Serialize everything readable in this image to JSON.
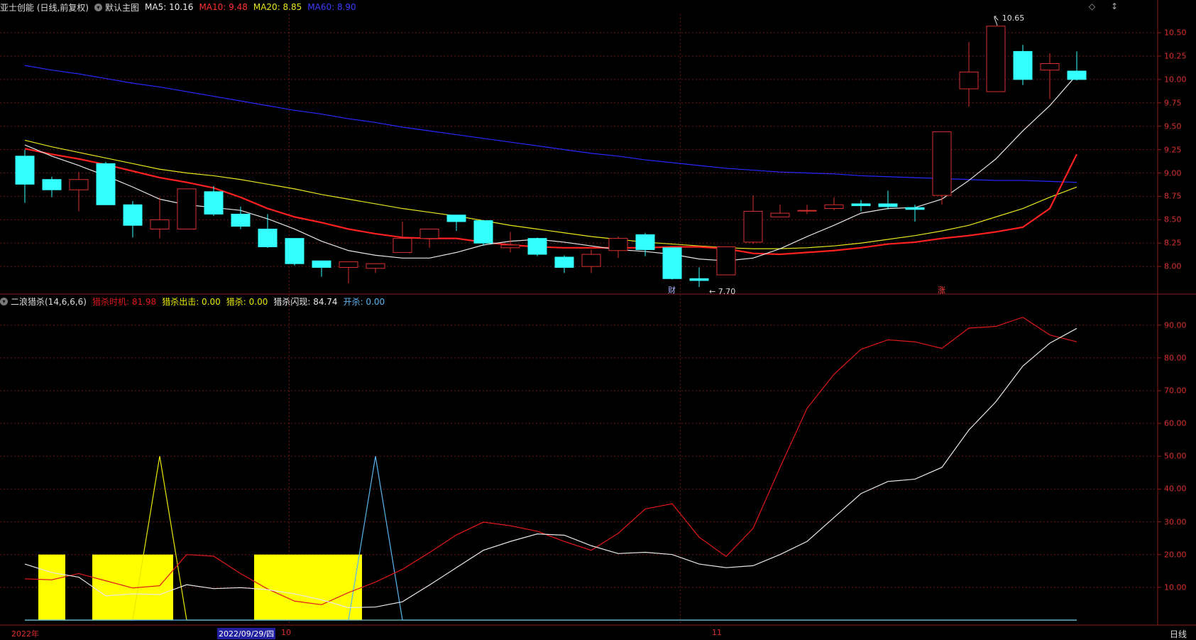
{
  "header_top": {
    "stock": "亚士创能 (日线,前复权)",
    "main_chart": "默认主图",
    "ma5": "MA5: 10.16",
    "ma10": "MA10: 9.48",
    "ma20": "MA20: 8.85",
    "ma60": "MA60: 8.90",
    "icons": [
      "diamond-icon",
      "arrow-updown-icon"
    ]
  },
  "header_bottom": {
    "indicator": "二浪猎杀(14,6,6,6)",
    "timing": "猎杀时机: 81.98",
    "strike": "猎杀出击: 0.00",
    "hunt": "猎杀: 0.00",
    "flash": "猎杀闪现: 84.74",
    "open": "开杀: 0.00"
  },
  "colors": {
    "up": "#d83030",
    "down": "#33ffff",
    "ma5": "#e6e6e6",
    "ma10": "#ff2020",
    "ma20": "#e6e61e",
    "ma60": "#2828ff",
    "timing": "#e01818",
    "flash": "#e8e8e8",
    "strike": "#e8e800",
    "open": "#5ab4f0",
    "bar": "#ffff00",
    "grid": "#6a1616"
  },
  "price_axis": [
    "10.50",
    "10.25",
    "10.00",
    "9.75",
    "9.50",
    "9.25",
    "9.00",
    "8.75",
    "8.50",
    "8.25",
    "8.00"
  ],
  "osc_axis": [
    "90.00",
    "80.00",
    "70.00",
    "60.00",
    "50.00",
    "40.00",
    "30.00",
    "20.00",
    "10.00"
  ],
  "annotations": {
    "high": "10.65",
    "low": "7.70",
    "cai": "财",
    "zhang": "涨"
  },
  "date_axis": {
    "year": "2022年",
    "cursor": "2022/09/29/四",
    "oct": "10",
    "nov": "11",
    "period": "日线"
  },
  "chart_data": {
    "type": "candlestick",
    "candles": [
      [
        9.18,
        8.88,
        9.25,
        8.68
      ],
      [
        8.93,
        8.82,
        8.96,
        8.74
      ],
      [
        8.82,
        8.93,
        9.01,
        8.59
      ],
      [
        9.1,
        8.66,
        9.12,
        8.66
      ],
      [
        8.66,
        8.44,
        8.7,
        8.31
      ],
      [
        8.4,
        8.5,
        8.74,
        8.3
      ],
      [
        8.4,
        8.83,
        8.83,
        8.4
      ],
      [
        8.8,
        8.56,
        8.86,
        8.54
      ],
      [
        8.56,
        8.43,
        8.64,
        8.4
      ],
      [
        8.4,
        8.21,
        8.56,
        8.2
      ],
      [
        8.3,
        8.03,
        8.3,
        8.01
      ],
      [
        8.06,
        7.99,
        8.06,
        7.89
      ],
      [
        7.99,
        8.05,
        8.05,
        7.82
      ],
      [
        7.98,
        8.03,
        8.03,
        7.93
      ],
      [
        8.15,
        8.3,
        8.48,
        8.15
      ],
      [
        8.3,
        8.4,
        8.4,
        8.2
      ],
      [
        8.55,
        8.48,
        8.55,
        8.38
      ],
      [
        8.49,
        8.25,
        8.49,
        8.22
      ],
      [
        8.2,
        8.23,
        8.37,
        8.15
      ],
      [
        8.3,
        8.13,
        8.31,
        8.11
      ],
      [
        8.1,
        7.99,
        8.12,
        7.93
      ],
      [
        8.0,
        8.13,
        8.18,
        7.93
      ],
      [
        8.17,
        8.3,
        8.32,
        8.09
      ],
      [
        8.34,
        8.18,
        8.36,
        8.11
      ],
      [
        8.2,
        7.87,
        8.2,
        7.86
      ],
      [
        7.87,
        7.85,
        7.99,
        7.78
      ],
      [
        7.91,
        8.21,
        8.21,
        7.91
      ],
      [
        8.26,
        8.59,
        8.76,
        8.24
      ],
      [
        8.53,
        8.57,
        8.66,
        8.53
      ],
      [
        8.6,
        8.6,
        8.66,
        8.56
      ],
      [
        8.62,
        8.66,
        8.74,
        8.6
      ],
      [
        8.67,
        8.65,
        8.71,
        8.59
      ],
      [
        8.67,
        8.64,
        8.81,
        8.61
      ],
      [
        8.63,
        8.61,
        8.66,
        8.48
      ],
      [
        8.76,
        9.44,
        9.44,
        8.66
      ],
      [
        9.9,
        10.08,
        10.4,
        9.71
      ],
      [
        9.87,
        10.57,
        10.57,
        9.87
      ],
      [
        10.3,
        10.0,
        10.37,
        9.94
      ],
      [
        10.1,
        10.17,
        10.28,
        9.79
      ],
      [
        10.09,
        10.0,
        10.3,
        9.99
      ]
    ],
    "ma5": [
      9.3,
      9.18,
      9.08,
      8.97,
      8.85,
      8.72,
      8.66,
      8.63,
      8.6,
      8.51,
      8.4,
      8.27,
      8.17,
      8.12,
      8.09,
      8.09,
      8.15,
      8.23,
      8.27,
      8.29,
      8.26,
      8.22,
      8.18,
      8.16,
      8.13,
      8.08,
      8.06,
      8.09,
      8.19,
      8.32,
      8.44,
      8.57,
      8.62,
      8.63,
      8.72,
      8.92,
      9.15,
      9.45,
      9.72,
      10.05
    ],
    "ma10": [
      9.26,
      9.2,
      9.15,
      9.09,
      9.02,
      8.95,
      8.9,
      8.84,
      8.74,
      8.62,
      8.53,
      8.47,
      8.4,
      8.35,
      8.31,
      8.3,
      8.3,
      8.26,
      8.23,
      8.21,
      8.2,
      8.2,
      8.2,
      8.2,
      8.21,
      8.21,
      8.19,
      8.14,
      8.13,
      8.15,
      8.17,
      8.2,
      8.24,
      8.26,
      8.3,
      8.33,
      8.37,
      8.42,
      8.62,
      9.2
    ],
    "ma20": [
      9.35,
      9.28,
      9.22,
      9.16,
      9.1,
      9.04,
      9.0,
      8.97,
      8.93,
      8.88,
      8.83,
      8.77,
      8.72,
      8.67,
      8.62,
      8.58,
      8.54,
      8.49,
      8.44,
      8.4,
      8.36,
      8.32,
      8.29,
      8.26,
      8.24,
      8.22,
      8.2,
      8.19,
      8.19,
      8.2,
      8.22,
      8.25,
      8.29,
      8.33,
      8.38,
      8.44,
      8.53,
      8.62,
      8.74,
      8.85
    ],
    "ma60": [
      10.15,
      10.1,
      10.06,
      10.01,
      9.96,
      9.92,
      9.87,
      9.82,
      9.77,
      9.72,
      9.67,
      9.63,
      9.58,
      9.54,
      9.49,
      9.45,
      9.41,
      9.37,
      9.33,
      9.29,
      9.25,
      9.21,
      9.18,
      9.14,
      9.11,
      9.08,
      9.05,
      9.03,
      9.01,
      9.0,
      8.99,
      8.97,
      8.96,
      8.95,
      8.94,
      8.93,
      8.92,
      8.92,
      8.91,
      8.9
    ],
    "timing": [
      12.6,
      12.3,
      14.2,
      12.0,
      9.8,
      10.5,
      20.0,
      19.5,
      14.2,
      9.5,
      5.8,
      4.7,
      8.4,
      11.6,
      15.5,
      20.6,
      26.0,
      29.9,
      28.8,
      27.1,
      24.0,
      21.3,
      26.5,
      33.9,
      35.5,
      25.3,
      19.4,
      28.0,
      46.6,
      64.6,
      75.0,
      82.6,
      85.5,
      84.9,
      82.9,
      89.1,
      89.6,
      92.4,
      87.0,
      84.9
    ],
    "flash": [
      17.1,
      14.5,
      13.1,
      7.4,
      8.0,
      7.8,
      10.8,
      9.6,
      9.9,
      9.3,
      8.0,
      6.2,
      3.8,
      4.0,
      5.6,
      10.7,
      16.0,
      21.3,
      24.0,
      26.3,
      25.9,
      22.7,
      20.3,
      20.7,
      20.0,
      17.1,
      16.0,
      16.6,
      20.0,
      24.0,
      31.3,
      38.6,
      42.3,
      43.0,
      46.6,
      58.0,
      66.6,
      77.5,
      84.5,
      89.0
    ],
    "strike": [
      0,
      0,
      0,
      0,
      0,
      50,
      0,
      0,
      0,
      0,
      0,
      0,
      0,
      0,
      0,
      0,
      0,
      0,
      0,
      0,
      0,
      0,
      0,
      0,
      0,
      0,
      0,
      0,
      0,
      0,
      0,
      0,
      0,
      0,
      0,
      0,
      0,
      0,
      0,
      0
    ],
    "open": [
      0,
      0,
      0,
      0,
      0,
      0,
      0,
      0,
      0,
      0,
      0,
      0,
      0,
      50,
      0,
      0,
      0,
      0,
      0,
      0,
      0,
      0,
      0,
      0,
      0,
      0,
      0,
      0,
      0,
      0,
      0,
      0,
      0,
      0,
      0,
      0,
      0,
      0,
      0,
      0
    ],
    "bars": [
      [
        1,
        1,
        20
      ],
      [
        3,
        5,
        20
      ],
      [
        9,
        12,
        20
      ]
    ],
    "ylim_price": [
      7.72,
      10.66
    ],
    "ylim_osc": [
      0,
      96
    ]
  }
}
